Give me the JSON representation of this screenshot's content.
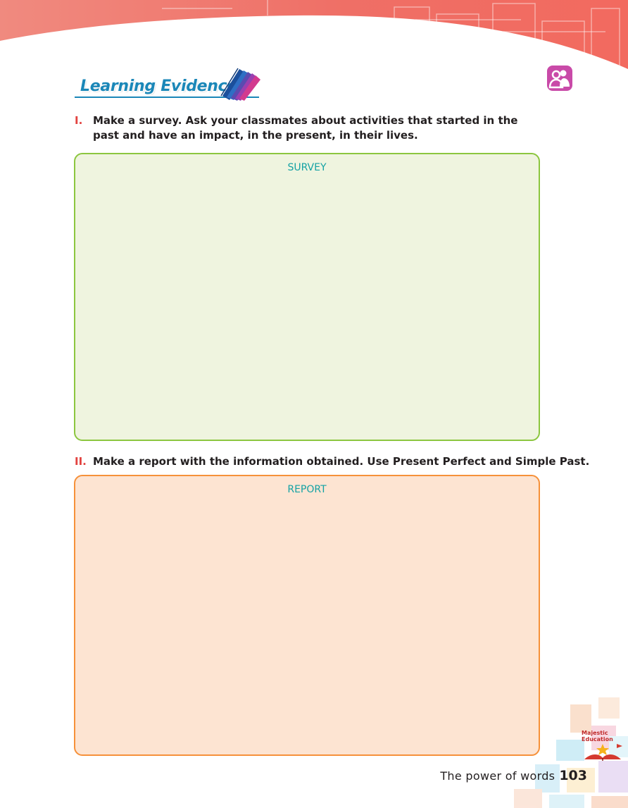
{
  "header": {
    "title": "Learning Evidence",
    "pair_work_icon": "pair-work-icon",
    "colors": {
      "band": "#f2746a",
      "title": "#1b87b8"
    }
  },
  "section_1": {
    "number": "I.",
    "instruction": "Make a survey. Ask your classmates about activities that started in the past and have an impact, in the present, in their lives.",
    "box_label": "SURVEY",
    "box_colors": {
      "fill": "#eff4df",
      "border": "#8cc63f"
    }
  },
  "section_2": {
    "number": "II.",
    "instruction": "Make a report with the information obtained. Use Present Perfect and Simple Past.",
    "box_label": "REPORT",
    "box_colors": {
      "fill": "#fde4d2",
      "border": "#f6913a"
    }
  },
  "brand": {
    "line1": "Majestic",
    "line2": "Education"
  },
  "footer": {
    "book_title": "The power of words",
    "page_number": "103"
  }
}
